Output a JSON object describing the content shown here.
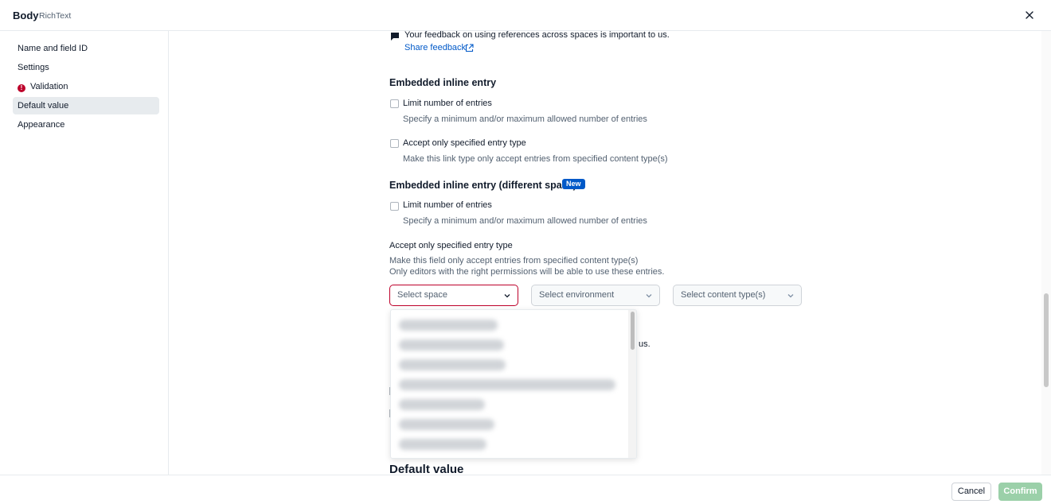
{
  "header": {
    "title": "Body",
    "subtitle": "RichText",
    "close_icon": "close-icon"
  },
  "sidebar": {
    "items": [
      {
        "label": "Name and field ID",
        "active": false,
        "error": false
      },
      {
        "label": "Settings",
        "active": false,
        "error": false
      },
      {
        "label": "Validation",
        "active": false,
        "error": true
      },
      {
        "label": "Default value",
        "active": true,
        "error": false
      },
      {
        "label": "Appearance",
        "active": false,
        "error": false
      }
    ]
  },
  "feedback": {
    "icon": "chat-bubble-icon",
    "text": "Your feedback on using references across spaces is important to us.",
    "link": "Share feedback",
    "link_icon": "external-link-icon",
    "text_tail": "us."
  },
  "embedded_inline": {
    "heading": "Embedded inline entry",
    "limit_label": "Limit number of entries",
    "limit_help": "Specify a minimum and/or maximum allowed number of entries",
    "accept_label": "Accept only specified entry type",
    "accept_help": "Make this link type only accept entries from specified content type(s)"
  },
  "embedded_inline_diff": {
    "heading": "Embedded inline entry (different space)",
    "badge": "New",
    "limit_label": "Limit number of entries",
    "limit_help": "Specify a minimum and/or maximum allowed number of entries",
    "accept_label": "Accept only specified entry type",
    "accept_help_1": "Make this field only accept entries from specified content type(s)",
    "accept_help_2": "Only editors with the right permissions will be able to use these entries."
  },
  "selects": {
    "space": "Select space",
    "environment": "Select environment",
    "content_type": "Select content type(s)"
  },
  "default_value": {
    "heading": "Default value"
  },
  "footer": {
    "cancel": "Cancel",
    "confirm": "Confirm"
  },
  "colors": {
    "accent": "#0059c8",
    "error": "#bd002a",
    "confirm_disabled": "#9bd0a9"
  }
}
